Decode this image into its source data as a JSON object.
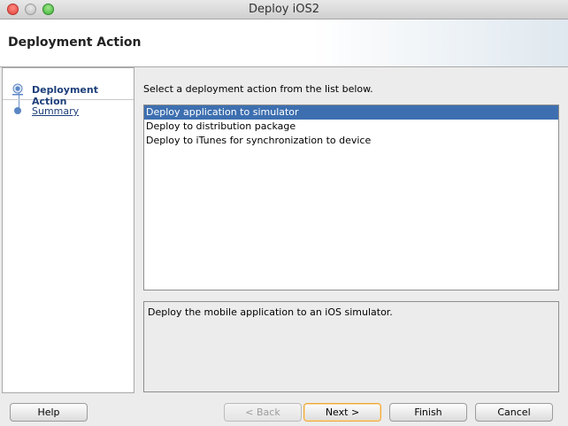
{
  "window": {
    "title": "Deploy iOS2"
  },
  "header": {
    "title": "Deployment Action"
  },
  "steps": [
    {
      "label": "Deployment Action",
      "state": "current"
    },
    {
      "label": "Summary",
      "state": "pending"
    }
  ],
  "main": {
    "instruction": "Select a deployment action from the list below.",
    "actions": [
      "Deploy application to simulator",
      "Deploy to distribution package",
      "Deploy to iTunes for synchronization to device"
    ],
    "selected_index": 0,
    "description": "Deploy the mobile application to an iOS simulator."
  },
  "buttons": {
    "help": "Help",
    "back": "< Back",
    "next": "Next >",
    "finish": "Finish",
    "cancel": "Cancel"
  },
  "colors": {
    "selection": "#3d6fb0",
    "step_text": "#1d3f7a",
    "default_button_border": "#f0a838"
  }
}
